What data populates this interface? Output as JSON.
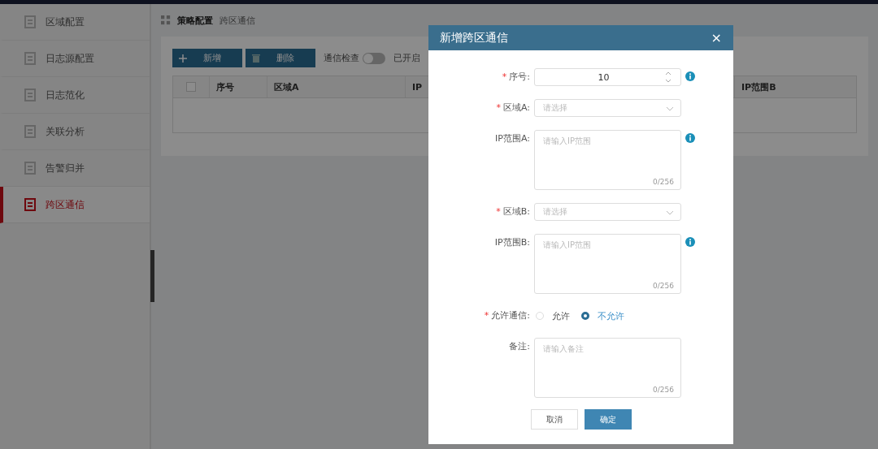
{
  "sidebar": {
    "items": [
      {
        "label": "区域配置",
        "selected": false
      },
      {
        "label": "日志源配置",
        "selected": false
      },
      {
        "label": "日志范化",
        "selected": false
      },
      {
        "label": "关联分析",
        "selected": false
      },
      {
        "label": "告警归并",
        "selected": false
      },
      {
        "label": "跨区通信",
        "selected": true
      }
    ]
  },
  "breadcrumb": [
    "策略配置",
    "跨区通信"
  ],
  "toolbar": {
    "add_button": "新增",
    "delete_button": "删除",
    "switch_label": "通信检查",
    "switch_on": false,
    "switch_status": "已开启"
  },
  "table": {
    "select_all_checked": false,
    "columns": [
      "序号",
      "区域A",
      "IP",
      "IP范围B"
    ]
  },
  "dialog": {
    "title": "新增跨区通信",
    "close": "×",
    "fields": [
      {
        "kind": "number",
        "label": "序号:",
        "required_mark": "*",
        "value": "10",
        "info": true
      },
      {
        "kind": "select",
        "label": "区域A:",
        "required_mark": "*",
        "placeholder": "请选择",
        "info": false
      },
      {
        "kind": "textarea",
        "label": "IP范围A:",
        "placeholder": "请输入IP范围",
        "counter": "0/256",
        "info": true
      },
      {
        "kind": "select",
        "label": "区域B:",
        "required_mark": "*",
        "placeholder": "请选择",
        "info": false
      },
      {
        "kind": "textarea",
        "label": "IP范围B:",
        "placeholder": "请输入IP范围",
        "counter": "0/256",
        "info": true
      },
      {
        "kind": "radio",
        "label": "允许通信:",
        "required_mark": "*",
        "options": [
          {
            "label": "允许",
            "selected": false
          },
          {
            "label": "不允许",
            "selected": true
          }
        ],
        "info": false
      },
      {
        "kind": "textarea",
        "label": "备注:",
        "placeholder": "请输入备注",
        "counter": "0/256",
        "info": false
      }
    ],
    "cancel_button": "取消",
    "confirm_button": "确定"
  }
}
